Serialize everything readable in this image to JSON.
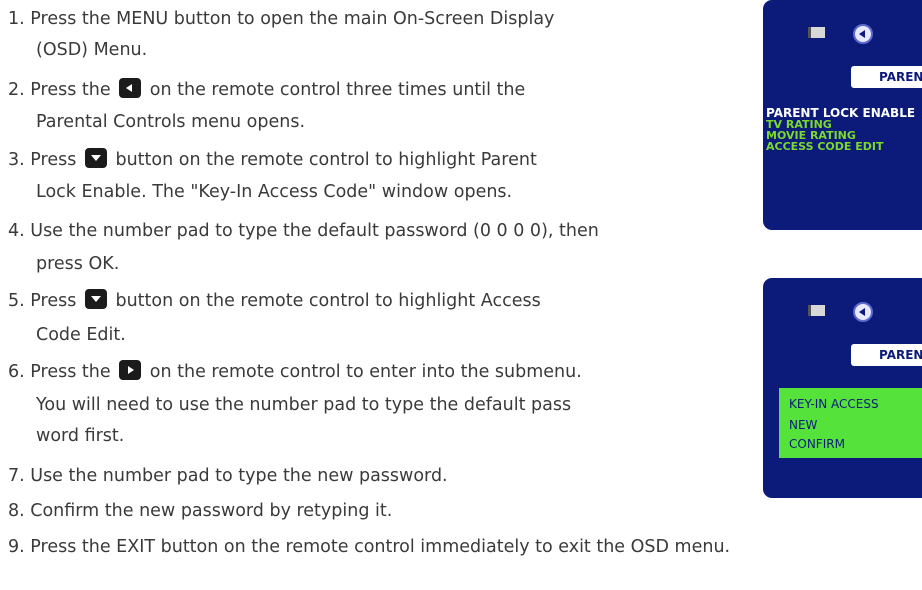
{
  "instructions": {
    "s1": {
      "a": "1. Press the MENU button to open the main On-Screen Display",
      "b": "(OSD) Menu."
    },
    "s2": {
      "pre": "2. Press the",
      "post": "on the remote control three times until the",
      "b": "Parental Controls menu opens."
    },
    "s3": {
      "pre": "3. Press",
      "post": "button on the remote control to highlight Parent",
      "b": "Lock Enable. The \"Key-In Access Code\" window opens."
    },
    "s4": {
      "a": "4. Use the number pad to type the default password (0 0 0 0), then",
      "b": "press OK."
    },
    "s5": {
      "pre": "5. Press",
      "post": "button on the remote control to highlight Access",
      "b": "Code Edit."
    },
    "s6": {
      "pre": "6. Press the",
      "post": "on the remote control to enter into the submenu.",
      "b": "You will need to use the number pad to type the default pass",
      "c": "word first."
    },
    "s7": "7. Use the number pad to type the new password.",
    "s8": "8. Confirm the new password by retyping it.",
    "s9": "9. Press the EXIT button on the remote control immediately to exit the OSD menu."
  },
  "icons": {
    "left_button": "left-arrow-button-icon",
    "down_button": "down-arrow-button-icon",
    "right_button": "right-arrow-button-icon",
    "camera": "camera-icon",
    "speaker": "speaker-icon"
  },
  "osd1": {
    "button": "PARENTAL",
    "items": [
      "PARENT LOCK ENABLE",
      "TV RATING",
      "MOVIE RATING",
      "ACCESS CODE EDIT"
    ]
  },
  "osd2": {
    "button": "PARENTAL",
    "items": [
      "KEY-IN ACCESS",
      "NEW",
      "CONFIRM"
    ]
  },
  "colors": {
    "osd_bg": "#0c1b7a",
    "osd_green_text": "#7ad92a",
    "osd_green_box": "#55e23a",
    "body_text": "#3a3a3a"
  }
}
